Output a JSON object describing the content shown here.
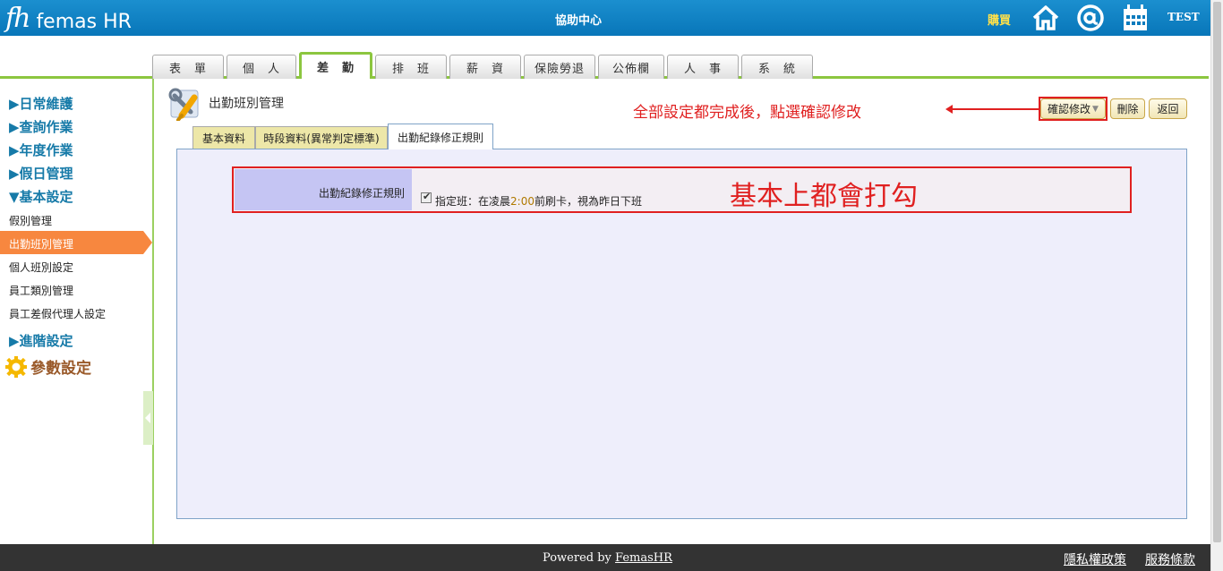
{
  "header": {
    "logo_mark": "fh",
    "logo_text": "femas HR",
    "center_title": "協助中心",
    "buy_label": "購買",
    "user_name": "TEST",
    "icons": [
      "home-icon",
      "mail-icon",
      "calendar-icon"
    ]
  },
  "main_tabs": [
    {
      "label": "表　單"
    },
    {
      "label": "個　人"
    },
    {
      "label": "差　勤"
    },
    {
      "label": "排　班"
    },
    {
      "label": "薪　資"
    },
    {
      "label": "保險勞退"
    },
    {
      "label": "公佈欄"
    },
    {
      "label": "人　事"
    },
    {
      "label": "系　統"
    }
  ],
  "main_tabs_active": "差　勤",
  "sidebar": {
    "categories": [
      {
        "label": "▶日常維護"
      },
      {
        "label": "▶查詢作業"
      },
      {
        "label": "▶年度作業"
      },
      {
        "label": "▶假日管理"
      },
      {
        "label": "▼基本設定"
      }
    ],
    "sub_items": [
      {
        "label": "假別管理"
      },
      {
        "label": "出勤班別管理"
      },
      {
        "label": "個人班別設定"
      },
      {
        "label": "員工類別管理"
      },
      {
        "label": "員工差假代理人設定"
      }
    ],
    "active_item": "出勤班別管理",
    "advanced_label": "▶進階設定",
    "params_label": "參數設定"
  },
  "page": {
    "title": "出勤班別管理",
    "annotation_top": "全部設定都完成後，點選確認修改",
    "buttons": {
      "confirm": "確認修改",
      "delete": "刪除",
      "back": "返回"
    },
    "sub_tabs": [
      {
        "label": "基本資料"
      },
      {
        "label": "時段資料(異常判定標準)"
      },
      {
        "label": "出勤紀錄修正規則"
      }
    ],
    "active_sub_tab": "出勤紀錄修正規則",
    "rule": {
      "label": "出勤紀錄修正規則",
      "checked": true,
      "text_before": "指定班：在凌晨",
      "time": "2:00",
      "text_after": "前刷卡，視為昨日下班"
    },
    "annotation_mid": "基本上都會打勾"
  },
  "footer": {
    "powered_prefix": "Powered by ",
    "powered_link": "FemasHR",
    "privacy": "隱私權政策",
    "terms": "服務條款"
  },
  "colors": {
    "topbar": "#0a7bbd",
    "accent_green": "#8cc63f",
    "sidebar_active": "#f7873f",
    "annotation_red": "#e02020",
    "panel_bg": "#eeeefb",
    "footer_bg": "#333333"
  }
}
